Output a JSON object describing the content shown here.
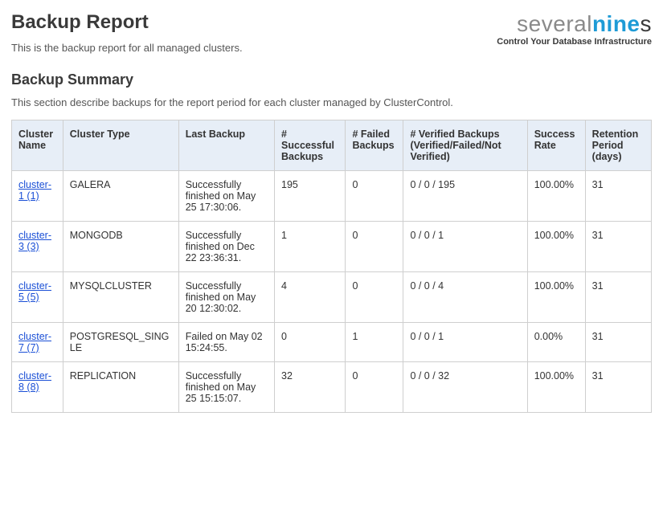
{
  "header": {
    "title": "Backup Report",
    "subtitle": "This is the backup report for all managed clusters."
  },
  "brand": {
    "word1": "several",
    "word2a": "nine",
    "word2b": "s",
    "tagline": "Control Your Database Infrastructure"
  },
  "summary": {
    "heading": "Backup Summary",
    "description": "This section describe backups for the report period for each cluster managed by ClusterControl."
  },
  "table": {
    "columns": {
      "name": "Cluster Name",
      "type": "Cluster Type",
      "last": "Last Backup",
      "successful": "# Successful Backups",
      "failed": "# Failed Backups",
      "verified": "# Verified Backups (Verified/Failed/Not Verified)",
      "rate": "Success Rate",
      "retention": "Retention Period (days)"
    },
    "rows": [
      {
        "name": "cluster-1 (1)",
        "type": "GALERA",
        "last": "Successfully finished on May 25 17:30:06.",
        "successful": "195",
        "failed": "0",
        "verified": "0 / 0 / 195",
        "rate": "100.00%",
        "retention": "31"
      },
      {
        "name": "cluster-3 (3)",
        "type": "MONGODB",
        "last": "Successfully finished on Dec 22 23:36:31.",
        "successful": "1",
        "failed": "0",
        "verified": "0 / 0 / 1",
        "rate": "100.00%",
        "retention": "31"
      },
      {
        "name": "cluster-5 (5)",
        "type": "MYSQLCLUSTER",
        "last": "Successfully finished on May 20 12:30:02.",
        "successful": "4",
        "failed": "0",
        "verified": "0 / 0 / 4",
        "rate": "100.00%",
        "retention": "31"
      },
      {
        "name": "cluster-7 (7)",
        "type": "POSTGRESQL_SINGLE",
        "last": "Failed on May 02 15:24:55.",
        "successful": "0",
        "failed": "1",
        "verified": "0 / 0 / 1",
        "rate": "0.00%",
        "retention": "31"
      },
      {
        "name": "cluster-8 (8)",
        "type": "REPLICATION",
        "last": "Successfully finished on May 25 15:15:07.",
        "successful": "32",
        "failed": "0",
        "verified": "0 / 0 / 32",
        "rate": "100.00%",
        "retention": "31"
      }
    ]
  }
}
